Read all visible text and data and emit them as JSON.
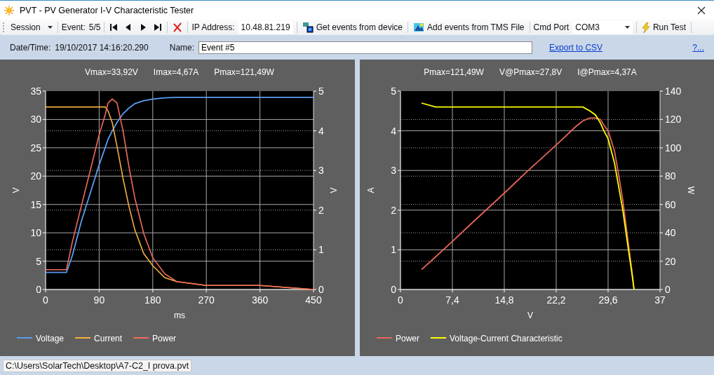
{
  "window": {
    "title": "PVT - PV Generator I-V Characteristic Tester"
  },
  "toolbar": {
    "session": "Session",
    "event_label": "Event:",
    "event_position": "5/5",
    "ip_label": "IP Address:",
    "ip_address": "10.48.81.219",
    "get_events": "Get events from device",
    "add_events": "Add events from TMS File",
    "cmd_port_label": "Cmd Port",
    "cmd_port": "COM3",
    "run_test": "Run Test"
  },
  "info_bar": {
    "datetime_label": "Date/Time:",
    "datetime": "19/10/2017 14:16:20.290",
    "name_label": "Name:",
    "name": "Event #5",
    "export_link": "Export to CSV",
    "help_link": "?..."
  },
  "panels": [
    {
      "readouts": [
        "Vmax=33,92V",
        "Imax=4,67A",
        "Pmax=121,49W"
      ],
      "chart_data": {
        "type": "line",
        "grid": true,
        "legend": true,
        "xlabel": "ms",
        "ylabel": "V",
        "y2label": "V",
        "xlim": [
          0,
          450
        ],
        "ylim": [
          0,
          35
        ],
        "y2lim": [
          0,
          5
        ],
        "xticks": [
          0,
          90,
          180,
          270,
          360,
          450
        ],
        "yticks": [
          0,
          5,
          10,
          15,
          20,
          25,
          30,
          35
        ],
        "y2ticks": [
          0,
          1,
          2,
          3,
          4,
          5
        ],
        "x": [
          0,
          35,
          45,
          60,
          75,
          90,
          100,
          105,
          112,
          120,
          130,
          140,
          150,
          165,
          180,
          200,
          220,
          270,
          360,
          450
        ],
        "series": [
          {
            "name": "Voltage",
            "color": "#5b9bf0",
            "axis": "y",
            "values": [
              3,
              3,
              6,
              12,
              17,
              22,
              25,
              26.5,
              28,
              29.5,
              31,
              32,
              32.8,
              33.3,
              33.6,
              33.8,
              33.9,
              33.9,
              33.9,
              33.9
            ]
          },
          {
            "name": "Current",
            "color": "#f5b042",
            "axis": "y2",
            "values": [
              4.6,
              4.6,
              4.6,
              4.6,
              4.6,
              4.6,
              4.6,
              4.5,
              4.2,
              3.6,
              2.8,
              2.1,
              1.5,
              0.9,
              0.6,
              0.3,
              0.2,
              0.1,
              0.1,
              0
            ]
          },
          {
            "name": "Power",
            "color": "#f26b5b",
            "axis": "y2",
            "values": [
              0.5,
              0.5,
              1.2,
              2.1,
              3,
              3.9,
              4.4,
              4.7,
              4.8,
              4.7,
              4,
              3.1,
              2.3,
              1.4,
              0.8,
              0.4,
              0.2,
              0.1,
              0.1,
              0
            ]
          }
        ]
      }
    },
    {
      "readouts": [
        "Pmax=121,49W",
        "V@Pmax=27,8V",
        "I@Pmax=4,37A"
      ],
      "chart_data": {
        "type": "line",
        "grid": true,
        "legend": true,
        "xlabel": "V",
        "ylabel": "A",
        "y2label": "W",
        "xlim": [
          0,
          37
        ],
        "ylim": [
          0,
          5
        ],
        "y2lim": [
          0,
          140
        ],
        "xticks": [
          0,
          {
            "value": 7.4,
            "label": "7,4"
          },
          {
            "value": 14.8,
            "label": "14,8"
          },
          {
            "value": 22.2,
            "label": "22,2"
          },
          {
            "value": 29.6,
            "label": "29,6"
          },
          37
        ],
        "yticks": [
          0,
          1,
          2,
          3,
          4,
          5
        ],
        "y2ticks": [
          0,
          20,
          40,
          60,
          80,
          100,
          120,
          140
        ],
        "x": [
          3,
          5,
          7.4,
          10,
          14.8,
          18,
          22.2,
          25,
          26,
          27,
          27.8,
          28.5,
          29,
          29.6,
          30.5,
          31,
          31.7,
          32.5,
          33,
          33.3
        ],
        "series": [
          {
            "name": "Power",
            "color": "#e8665a",
            "axis": "y2",
            "values": [
              14,
              23,
              34,
              46,
              68,
              83,
              102,
              115,
              119,
              121,
              121,
              120,
              116,
              112,
              98,
              84,
              63,
              32,
              13,
              0
            ]
          },
          {
            "name": "Voltage-Current Characteristic",
            "color": "#ffff00",
            "axis": "y",
            "values": [
              4.7,
              4.6,
              4.6,
              4.6,
              4.6,
              4.6,
              4.6,
              4.6,
              4.6,
              4.5,
              4.4,
              4.2,
              4,
              3.8,
              3.2,
              2.7,
              2,
              1,
              0.4,
              0
            ]
          }
        ]
      }
    }
  ],
  "status_bar": {
    "file_path": "C:\\Users\\SolarTech\\Desktop\\A7-C2_I prova.pvt"
  }
}
